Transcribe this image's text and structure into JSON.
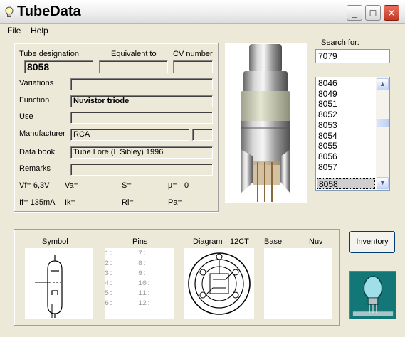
{
  "window": {
    "title": "TubeData",
    "icon": "lightbulb-icon"
  },
  "menu": {
    "file": "File",
    "help": "Help"
  },
  "fields": {
    "tube_designation_label": "Tube designation",
    "tube_designation": "8058",
    "equivalent_label": "Equivalent to",
    "equivalent": "",
    "cv_label": "CV number",
    "cv": "",
    "variations_label": "Variations",
    "variations": "",
    "function_label": "Function",
    "function": "Nuvistor triode",
    "use_label": "Use",
    "use": "",
    "manufacturer_label": "Manufacturer",
    "manufacturer": "RCA",
    "manufacturer_extra": "",
    "databook_label": "Data book",
    "databook": "Tube Lore (L Sibley) 1996",
    "remarks_label": "Remarks",
    "remarks": ""
  },
  "params": {
    "vf": "Vf= 6,3V",
    "va": "Va=",
    "s": "S=",
    "mu": "µ=",
    "mu_value": "0",
    "if": "If= 135mA",
    "ik": "Ik=",
    "ri": "Ri=",
    "pa": "Pa="
  },
  "search": {
    "label": "Search for:",
    "value": "7079"
  },
  "list": {
    "items": [
      "8046",
      "8049",
      "8051",
      "8052",
      "8053",
      "8054",
      "8055",
      "8056",
      "8057",
      "8058"
    ],
    "selected": "8058"
  },
  "bottom": {
    "symbol_label": "Symbol",
    "pins_label": "Pins",
    "diagram_label": "Diagram",
    "diagram_code": "12CT",
    "base_label": "Base",
    "base_value": "Nuv",
    "pins_left": [
      "1:",
      "2:",
      "3:",
      "4:",
      "5:",
      "6:"
    ],
    "pins_right": [
      "7:",
      "8:",
      "9:",
      "10:",
      "11:",
      "12:"
    ]
  },
  "inventory_button": "Inventory",
  "colors": {
    "window_bg": "#ece9d8",
    "close_button": "#c23a22",
    "selection": "#cfcfcf",
    "logo_bg": "#0f6a6e"
  }
}
